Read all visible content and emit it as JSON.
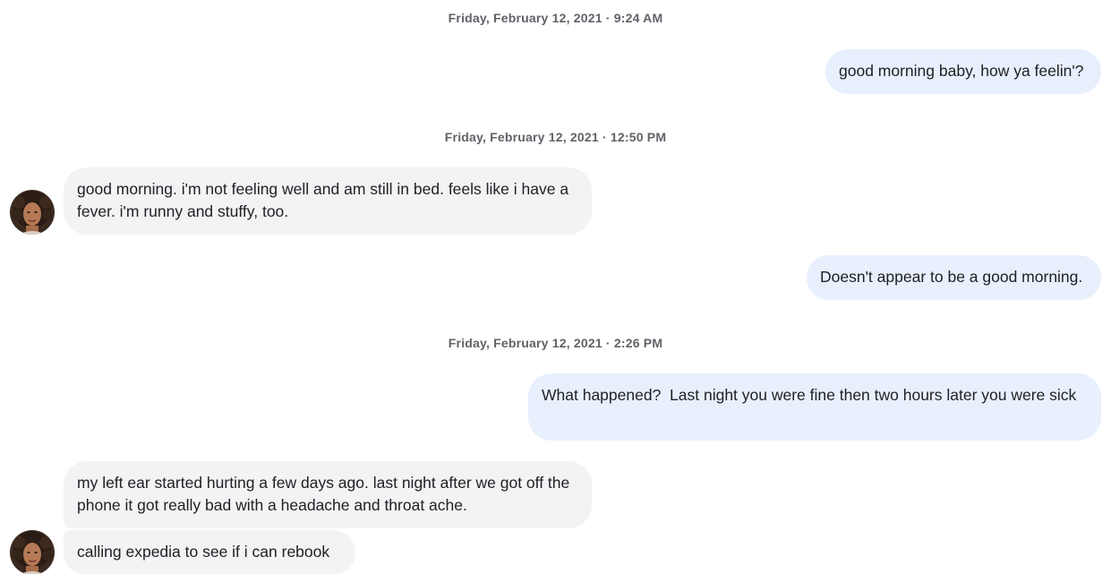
{
  "conversation": {
    "timestamps": [
      "Friday, February 12, 2021 · 9:24 AM",
      "Friday, February 12, 2021 · 12:50 PM",
      "Friday, February 12, 2021 · 2:26 PM"
    ],
    "messages": [
      {
        "direction": "outgoing",
        "text": "good morning baby, how ya feelin'?"
      },
      {
        "direction": "incoming",
        "text": "good morning. i'm not feeling well and am still in bed. feels like i have a fever. i'm runny and stuffy, too."
      },
      {
        "direction": "outgoing",
        "text": "Doesn't appear to be a good morning."
      },
      {
        "direction": "outgoing",
        "text": "What happened?  Last night you were fine then two hours later you were sick"
      },
      {
        "direction": "incoming",
        "text": "my left ear started hurting a few days ago. last night after we got off the phone it got really bad with a headache and throat ache."
      },
      {
        "direction": "incoming",
        "text": "calling expedia to see if i can rebook"
      }
    ]
  },
  "colors": {
    "outgoing_bubble": "#e8f0fe",
    "incoming_bubble": "#f1f3f4",
    "timestamp_text": "#5f6368",
    "message_text": "#202124"
  },
  "icons": {
    "avatar": "contact-avatar-photo"
  }
}
